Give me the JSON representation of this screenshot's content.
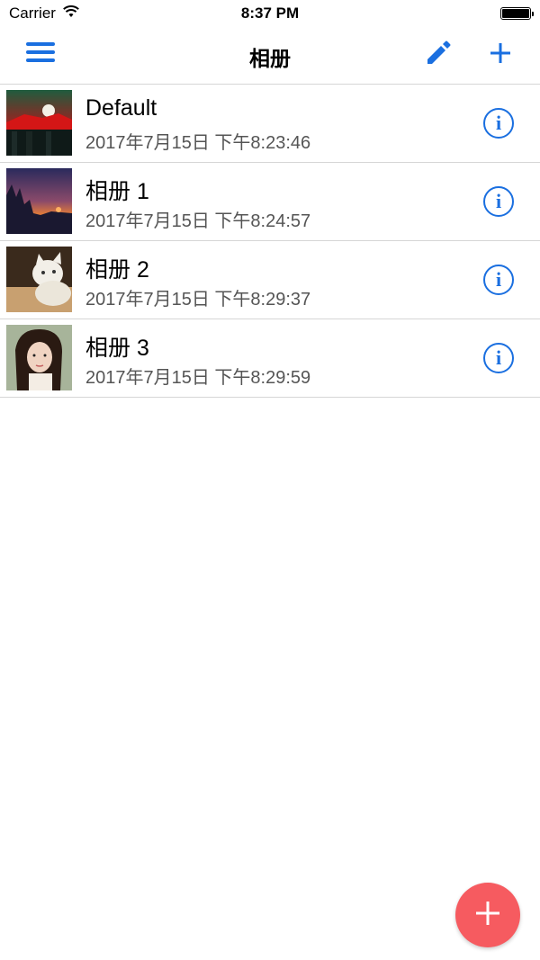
{
  "status_bar": {
    "carrier": "Carrier",
    "time": "8:37 PM"
  },
  "nav": {
    "title": "相册"
  },
  "albums": [
    {
      "name": "Default",
      "date": "2017年7月15日 下午8:23:46",
      "thumb": "mountain-sunset"
    },
    {
      "name": "相册 1",
      "date": "2017年7月15日 下午8:24:57",
      "thumb": "forest-dusk"
    },
    {
      "name": "相册 2",
      "date": "2017年7月15日 下午8:29:37",
      "thumb": "white-cat"
    },
    {
      "name": "相册 3",
      "date": "2017年7月15日 下午8:29:59",
      "thumb": "portrait"
    }
  ],
  "colors": {
    "accent": "#1a6fe0",
    "fab": "#f65b60",
    "separator": "#d6d6d6"
  },
  "icons": {
    "menu": "hamburger-menu-icon",
    "edit": "pencil-icon",
    "add": "plus-icon",
    "info": "info-icon",
    "fab": "plus-icon"
  }
}
